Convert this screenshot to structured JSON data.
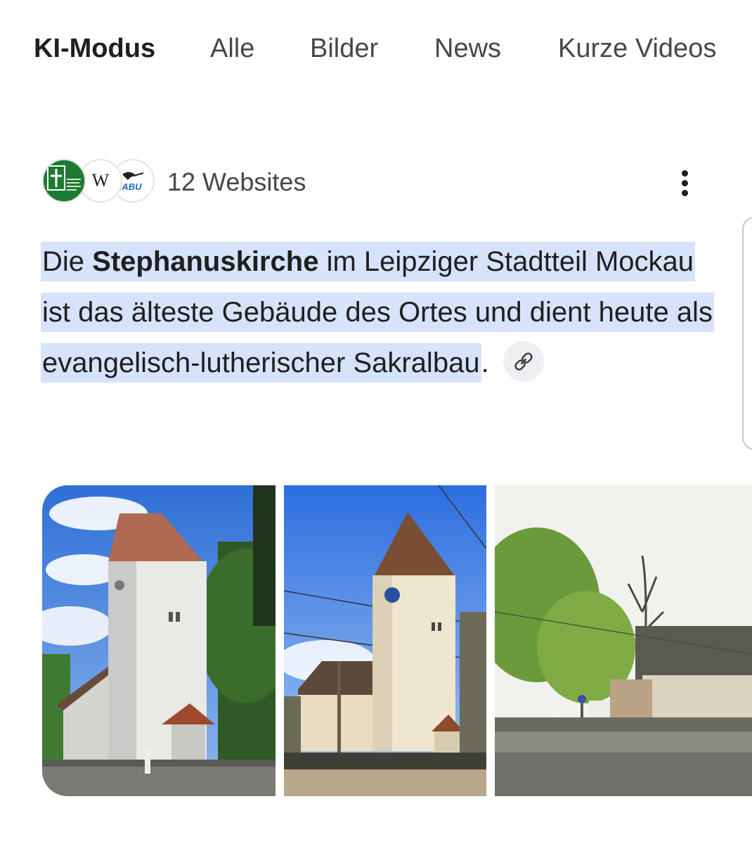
{
  "tabs": [
    {
      "label": "KI-Modus",
      "active": true
    },
    {
      "label": "Alle",
      "active": false
    },
    {
      "label": "Bilder",
      "active": false
    },
    {
      "label": "News",
      "active": false
    },
    {
      "label": "Kurze Videos",
      "active": false
    }
  ],
  "sources": {
    "label": "12 Websites",
    "favicons": [
      "green-church-logo-icon",
      "wikipedia-icon",
      "nabu-icon"
    ],
    "wikipedia_letter": "W",
    "nabu_text": "NABU"
  },
  "answer": {
    "part1": "Die ",
    "bold": "Stephanuskirche",
    "part2": " im Leipziger Stadtteil Mockau ist das älteste Gebäude des Ortes und dient heute als evangelisch-lutherischer Sakralbau",
    "end": "."
  },
  "images": [
    {
      "alt": "church-photo-1"
    },
    {
      "alt": "church-photo-2"
    },
    {
      "alt": "church-photo-3"
    }
  ],
  "colors": {
    "highlight": "#d6e3fb",
    "text": "#1f1f1f",
    "muted": "#474747",
    "chip": "#eeeff2"
  }
}
